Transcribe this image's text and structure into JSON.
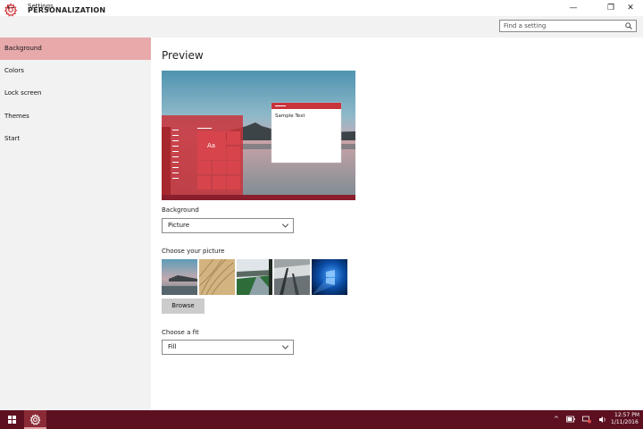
{
  "window": {
    "title": "Settings",
    "back_glyph": "←",
    "minimize_glyph": "—",
    "maximize_glyph": "❐",
    "close_glyph": "✕"
  },
  "header": {
    "title": "PERSONALIZATION",
    "icon": "gear-icon",
    "search_placeholder": "Find a setting",
    "search_icon": "search-icon"
  },
  "sidebar": {
    "items": [
      {
        "label": "Background",
        "active": true
      },
      {
        "label": "Colors",
        "active": false
      },
      {
        "label": "Lock screen",
        "active": false
      },
      {
        "label": "Themes",
        "active": false
      },
      {
        "label": "Start",
        "active": false
      }
    ]
  },
  "main": {
    "preview_title": "Preview",
    "preview": {
      "sample_text": "Sample Text",
      "tile_text": "Aa"
    },
    "background_label": "Background",
    "background_value": "Picture",
    "choose_picture_label": "Choose your picture",
    "browse_label": "Browse",
    "fit_label": "Choose a fit",
    "fit_value": "Fill"
  },
  "taskbar": {
    "time": "12:57 PM",
    "date": "1/11/2016",
    "tray_arrow": "^"
  },
  "colors": {
    "accent": "#d13438",
    "sidebar_active": "#e8a9ab",
    "taskbar": "#5c1020"
  }
}
